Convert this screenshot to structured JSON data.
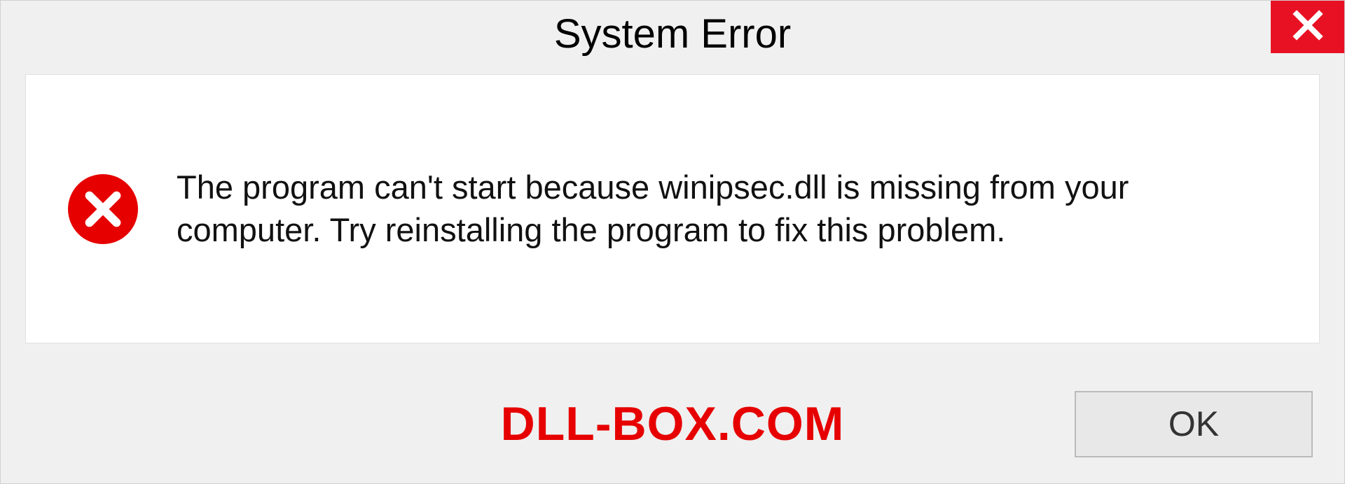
{
  "dialog": {
    "title": "System Error",
    "message": "The program can't start because winipsec.dll is missing from your computer. Try reinstalling the program to fix this problem.",
    "ok_label": "OK"
  },
  "watermark": "DLL-BOX.COM",
  "icons": {
    "close": "close-icon",
    "error": "error-circle-x-icon"
  },
  "colors": {
    "close_bg": "#e81123",
    "error_red": "#e60000",
    "dialog_bg": "#f0f0f0",
    "content_bg": "#ffffff"
  }
}
